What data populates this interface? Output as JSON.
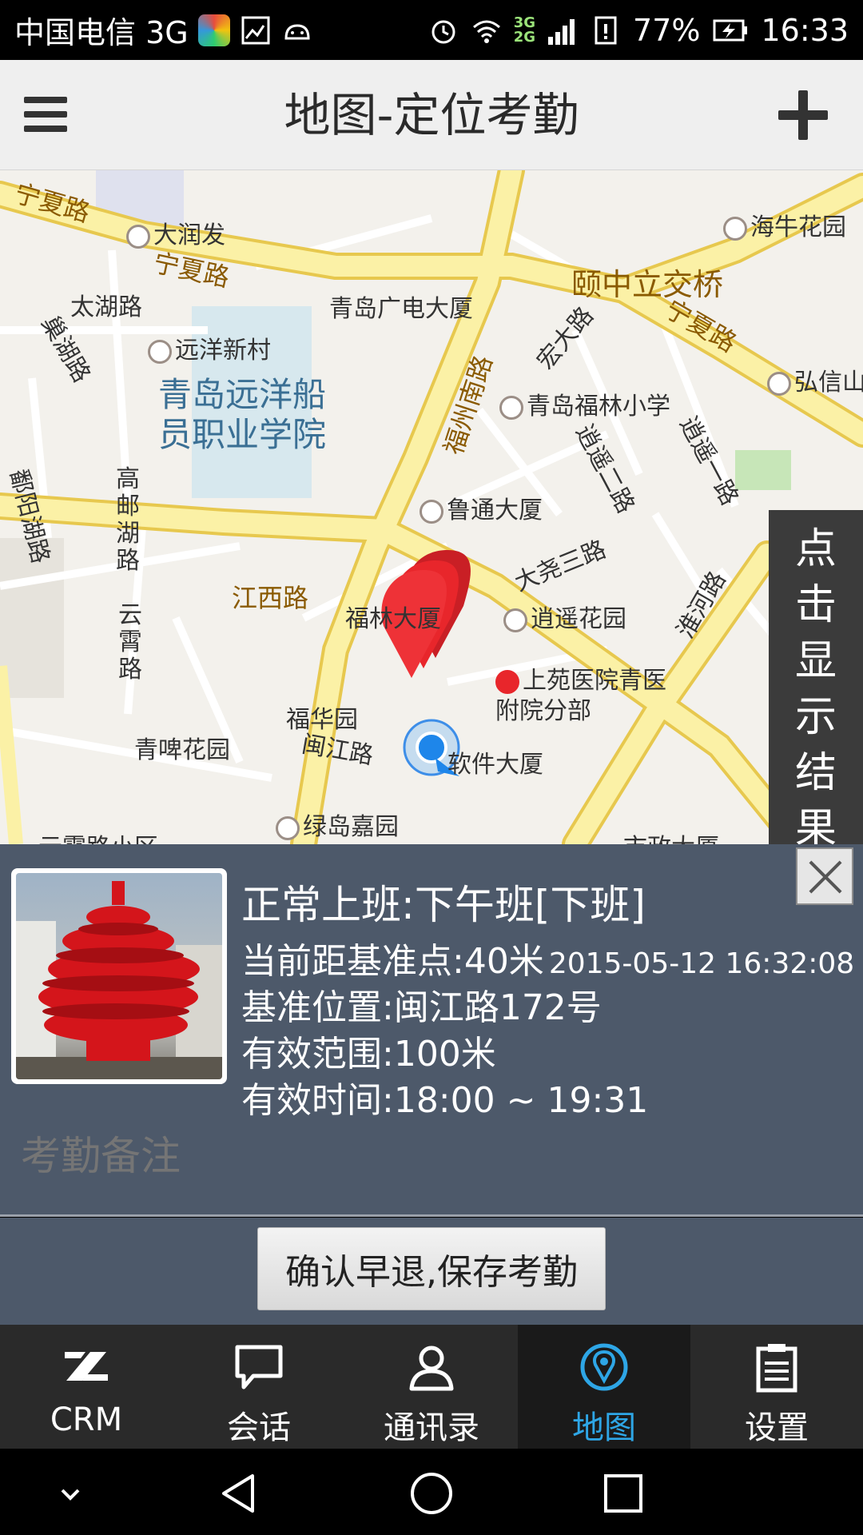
{
  "status_bar": {
    "carrier": "中国电信 3G",
    "network_top": "3G",
    "network_bottom": "2G",
    "battery": "77%",
    "time": "16:33"
  },
  "header": {
    "title": "地图-定位考勤",
    "menu_icon": "hamburger-menu-icon",
    "add_icon": "plus-icon"
  },
  "map": {
    "side_panel_text": "点击显示结果页",
    "labels": {
      "ningxia1": "宁夏路",
      "ningxia2": "宁夏路",
      "ningxia3": "宁夏路",
      "darunfa": "大润发",
      "hainiu": "海牛花园",
      "taihu": "太湖路",
      "guangdian": "青岛广电大厦",
      "yizhongli": "颐中立交桥",
      "chaohu": "巢湖路",
      "yuanyang_xc": "远洋新村",
      "fuzhou_nan": "福州南路",
      "hongda": "宏大路",
      "hongxin": "弘信山",
      "school": "青岛远洋船员职业学院",
      "fulin_school": "青岛福林小学",
      "xiaoyao2": "逍遥二路",
      "xiaoyao1": "逍遥一路",
      "gaoyou": "高邮湖路",
      "poyang": "鄱阳湖路",
      "lutong": "鲁通大厦",
      "dayao3": "大尧三路",
      "jiangxi": "江西路",
      "fulin_tower": "福林大厦",
      "xiaoyao_garden": "逍遥花园",
      "yunxiao": "云霄路",
      "huaihe": "淮河路",
      "hospital": "上苑医院青医附院分部",
      "fuhua": "福华园",
      "minjiang": "闽江路",
      "software": "软件大厦",
      "qingpi": "青啤花园",
      "lvdao": "绿岛嘉园",
      "yunxiao_xq": "云霄路小区",
      "shizheng": "市政大厦"
    }
  },
  "info": {
    "title": "正常上班:下午班[下班]",
    "distance": "当前距基准点:40米",
    "timestamp": "2015-05-12 16:32:08",
    "base_location": "基准位置:闽江路172号",
    "range": "有效范围:100米",
    "valid_time": "有效时间:18:00 ~ 19:31",
    "remark_placeholder": "考勤备注"
  },
  "confirm_button": "确认早退,保存考勤",
  "nav": {
    "items": [
      {
        "label": "CRM",
        "icon": "crm-logo-icon"
      },
      {
        "label": "会话",
        "icon": "chat-bubble-icon"
      },
      {
        "label": "通讯录",
        "icon": "contacts-person-icon"
      },
      {
        "label": "地图",
        "icon": "map-pin-icon",
        "active": true
      },
      {
        "label": "设置",
        "icon": "clipboard-settings-icon"
      }
    ]
  },
  "colors": {
    "panel_bg": "#4d596a",
    "nav_active": "#2ea6e6",
    "road_yellow": "#fbe98d",
    "marker_red": "#e8262b"
  }
}
